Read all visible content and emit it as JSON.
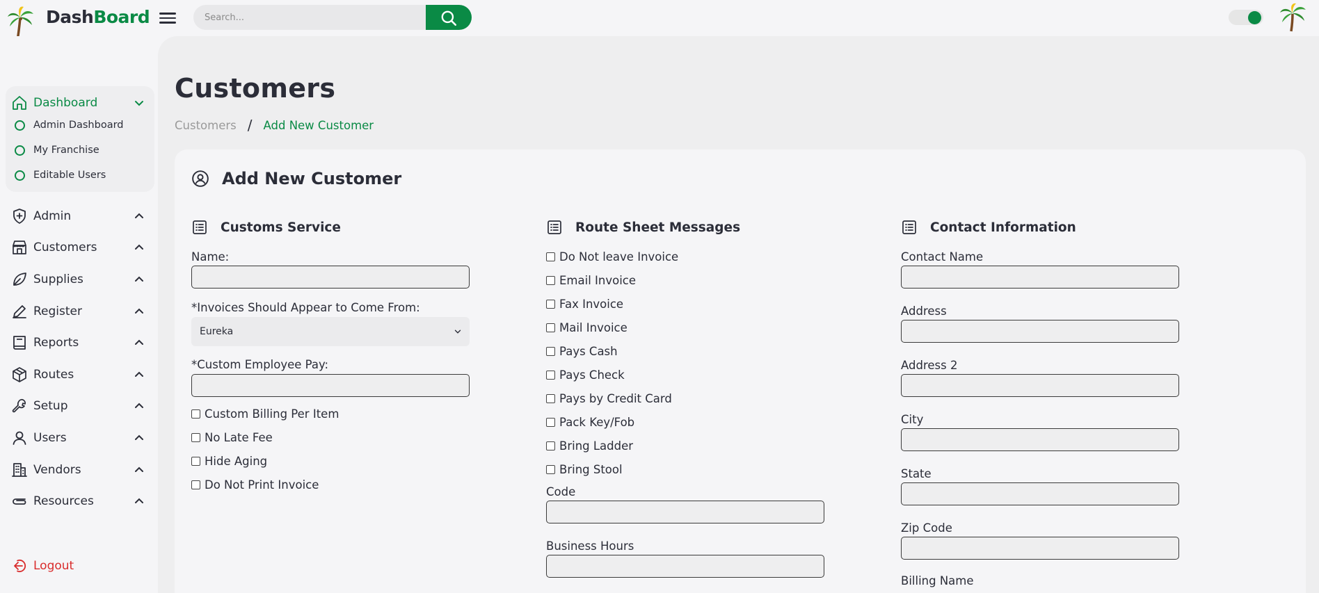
{
  "header": {
    "brand_part1": "Dash",
    "brand_part2": "Board",
    "search_placeholder": "Search...",
    "accent_color": "#0a8a45"
  },
  "sidebar": {
    "dashboard": {
      "label": "Dashboard",
      "items": [
        "Admin Dashboard",
        "My Franchise",
        "Editable Users"
      ]
    },
    "items": [
      {
        "label": "Admin",
        "icon": "shield-plus-icon"
      },
      {
        "label": "Customers",
        "icon": "store-icon"
      },
      {
        "label": "Supplies",
        "icon": "leaf-icon"
      },
      {
        "label": "Register",
        "icon": "pen-icon"
      },
      {
        "label": "Reports",
        "icon": "book-icon"
      },
      {
        "label": "Routes",
        "icon": "box-icon"
      },
      {
        "label": "Setup",
        "icon": "wrench-icon"
      },
      {
        "label": "Users",
        "icon": "user-icon"
      },
      {
        "label": "Vendors",
        "icon": "building-icon"
      },
      {
        "label": "Resources",
        "icon": "paperclip-icon"
      }
    ],
    "logout": "Logout"
  },
  "main": {
    "page_title": "Customers",
    "breadcrumb": {
      "parent": "Customers",
      "separator": "/",
      "current": "Add New Customer"
    },
    "card_title": "Add New Customer",
    "customs_service": {
      "title": "Customs Service",
      "name_label": "Name:",
      "invoices_label": "*Invoices Should Appear to Come From:",
      "invoices_value": "Eureka",
      "employee_pay_label": "*Custom Employee Pay:",
      "checkboxes": [
        "Custom Billing Per Item",
        "No Late Fee",
        "Hide Aging",
        "Do Not Print Invoice"
      ]
    },
    "route_sheet": {
      "title": "Route Sheet Messages",
      "checkboxes": [
        "Do Not leave Invoice",
        "Email Invoice",
        "Fax Invoice",
        "Mail Invoice",
        "Pays Cash",
        "Pays Check",
        "Pays by Credit Card",
        "Pack Key/Fob",
        "Bring Ladder",
        "Bring Stool"
      ],
      "code_label": "Code",
      "business_hours_label": "Business Hours"
    },
    "contact": {
      "title": "Contact Information",
      "fields": [
        "Contact Name",
        "Address",
        "Address 2",
        "City",
        "State",
        "Zip Code",
        "Billing Name"
      ]
    }
  }
}
